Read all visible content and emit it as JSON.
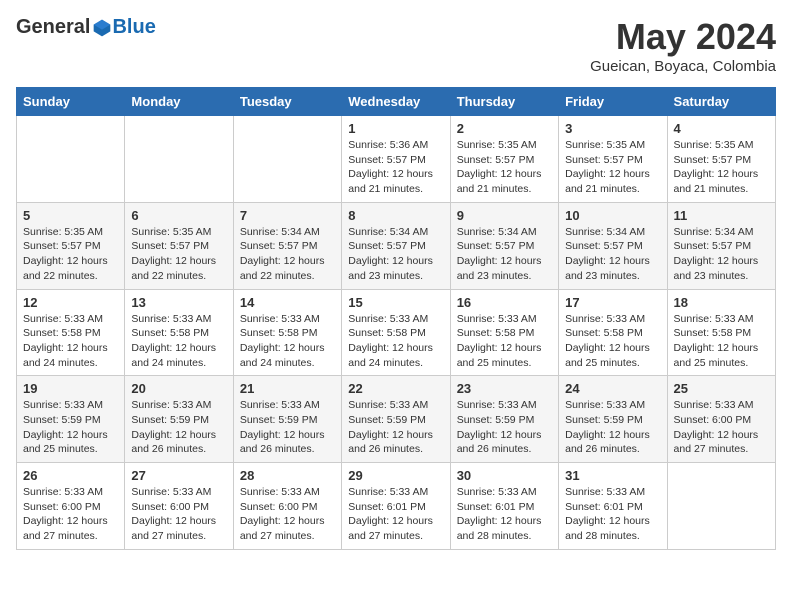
{
  "header": {
    "logo_general": "General",
    "logo_blue": "Blue",
    "month_title": "May 2024",
    "subtitle": "Gueican, Boyaca, Colombia"
  },
  "days_of_week": [
    "Sunday",
    "Monday",
    "Tuesday",
    "Wednesday",
    "Thursday",
    "Friday",
    "Saturday"
  ],
  "weeks": [
    [
      {
        "num": "",
        "info": ""
      },
      {
        "num": "",
        "info": ""
      },
      {
        "num": "",
        "info": ""
      },
      {
        "num": "1",
        "info": "Sunrise: 5:36 AM\nSunset: 5:57 PM\nDaylight: 12 hours\nand 21 minutes."
      },
      {
        "num": "2",
        "info": "Sunrise: 5:35 AM\nSunset: 5:57 PM\nDaylight: 12 hours\nand 21 minutes."
      },
      {
        "num": "3",
        "info": "Sunrise: 5:35 AM\nSunset: 5:57 PM\nDaylight: 12 hours\nand 21 minutes."
      },
      {
        "num": "4",
        "info": "Sunrise: 5:35 AM\nSunset: 5:57 PM\nDaylight: 12 hours\nand 21 minutes."
      }
    ],
    [
      {
        "num": "5",
        "info": "Sunrise: 5:35 AM\nSunset: 5:57 PM\nDaylight: 12 hours\nand 22 minutes."
      },
      {
        "num": "6",
        "info": "Sunrise: 5:35 AM\nSunset: 5:57 PM\nDaylight: 12 hours\nand 22 minutes."
      },
      {
        "num": "7",
        "info": "Sunrise: 5:34 AM\nSunset: 5:57 PM\nDaylight: 12 hours\nand 22 minutes."
      },
      {
        "num": "8",
        "info": "Sunrise: 5:34 AM\nSunset: 5:57 PM\nDaylight: 12 hours\nand 23 minutes."
      },
      {
        "num": "9",
        "info": "Sunrise: 5:34 AM\nSunset: 5:57 PM\nDaylight: 12 hours\nand 23 minutes."
      },
      {
        "num": "10",
        "info": "Sunrise: 5:34 AM\nSunset: 5:57 PM\nDaylight: 12 hours\nand 23 minutes."
      },
      {
        "num": "11",
        "info": "Sunrise: 5:34 AM\nSunset: 5:57 PM\nDaylight: 12 hours\nand 23 minutes."
      }
    ],
    [
      {
        "num": "12",
        "info": "Sunrise: 5:33 AM\nSunset: 5:58 PM\nDaylight: 12 hours\nand 24 minutes."
      },
      {
        "num": "13",
        "info": "Sunrise: 5:33 AM\nSunset: 5:58 PM\nDaylight: 12 hours\nand 24 minutes."
      },
      {
        "num": "14",
        "info": "Sunrise: 5:33 AM\nSunset: 5:58 PM\nDaylight: 12 hours\nand 24 minutes."
      },
      {
        "num": "15",
        "info": "Sunrise: 5:33 AM\nSunset: 5:58 PM\nDaylight: 12 hours\nand 24 minutes."
      },
      {
        "num": "16",
        "info": "Sunrise: 5:33 AM\nSunset: 5:58 PM\nDaylight: 12 hours\nand 25 minutes."
      },
      {
        "num": "17",
        "info": "Sunrise: 5:33 AM\nSunset: 5:58 PM\nDaylight: 12 hours\nand 25 minutes."
      },
      {
        "num": "18",
        "info": "Sunrise: 5:33 AM\nSunset: 5:58 PM\nDaylight: 12 hours\nand 25 minutes."
      }
    ],
    [
      {
        "num": "19",
        "info": "Sunrise: 5:33 AM\nSunset: 5:59 PM\nDaylight: 12 hours\nand 25 minutes."
      },
      {
        "num": "20",
        "info": "Sunrise: 5:33 AM\nSunset: 5:59 PM\nDaylight: 12 hours\nand 26 minutes."
      },
      {
        "num": "21",
        "info": "Sunrise: 5:33 AM\nSunset: 5:59 PM\nDaylight: 12 hours\nand 26 minutes."
      },
      {
        "num": "22",
        "info": "Sunrise: 5:33 AM\nSunset: 5:59 PM\nDaylight: 12 hours\nand 26 minutes."
      },
      {
        "num": "23",
        "info": "Sunrise: 5:33 AM\nSunset: 5:59 PM\nDaylight: 12 hours\nand 26 minutes."
      },
      {
        "num": "24",
        "info": "Sunrise: 5:33 AM\nSunset: 5:59 PM\nDaylight: 12 hours\nand 26 minutes."
      },
      {
        "num": "25",
        "info": "Sunrise: 5:33 AM\nSunset: 6:00 PM\nDaylight: 12 hours\nand 27 minutes."
      }
    ],
    [
      {
        "num": "26",
        "info": "Sunrise: 5:33 AM\nSunset: 6:00 PM\nDaylight: 12 hours\nand 27 minutes."
      },
      {
        "num": "27",
        "info": "Sunrise: 5:33 AM\nSunset: 6:00 PM\nDaylight: 12 hours\nand 27 minutes."
      },
      {
        "num": "28",
        "info": "Sunrise: 5:33 AM\nSunset: 6:00 PM\nDaylight: 12 hours\nand 27 minutes."
      },
      {
        "num": "29",
        "info": "Sunrise: 5:33 AM\nSunset: 6:01 PM\nDaylight: 12 hours\nand 27 minutes."
      },
      {
        "num": "30",
        "info": "Sunrise: 5:33 AM\nSunset: 6:01 PM\nDaylight: 12 hours\nand 28 minutes."
      },
      {
        "num": "31",
        "info": "Sunrise: 5:33 AM\nSunset: 6:01 PM\nDaylight: 12 hours\nand 28 minutes."
      },
      {
        "num": "",
        "info": ""
      }
    ]
  ]
}
